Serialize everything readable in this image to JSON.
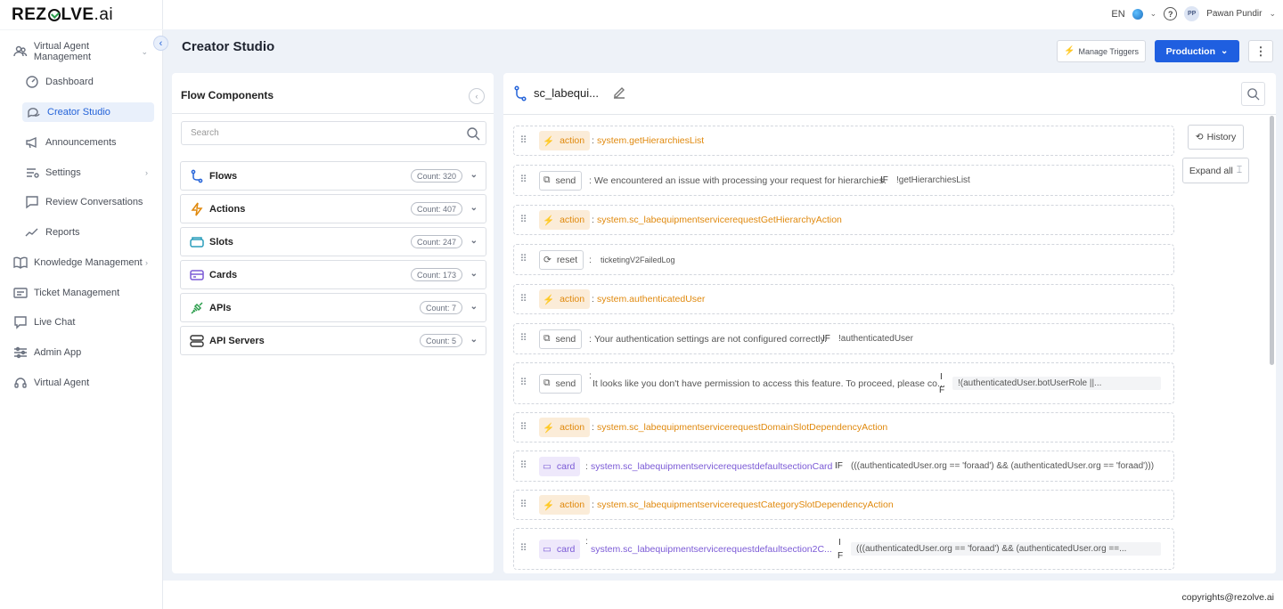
{
  "app": {
    "logo_main": "REZ",
    "logo_rest": "LVE",
    "logo_ai": ".ai",
    "page_title": "Creator Studio",
    "footer": "copyrights@rezolve.ai"
  },
  "topbar": {
    "language": "EN",
    "avatar_initials": "PP",
    "user_name": "Pawan Pundir"
  },
  "header_actions": {
    "manage_triggers": "Manage Triggers",
    "environment": "Production"
  },
  "sidebar": {
    "items": [
      {
        "label": "Virtual Agent Management",
        "icon": "users-icon"
      },
      {
        "label": "Dashboard",
        "icon": "gauge-icon"
      },
      {
        "label": "Creator Studio",
        "icon": "chat-icon"
      },
      {
        "label": "Announcements",
        "icon": "megaphone-icon"
      },
      {
        "label": "Settings",
        "icon": "settings-icon"
      },
      {
        "label": "Review Conversations",
        "icon": "message-square-icon"
      },
      {
        "label": "Reports",
        "icon": "trend-icon"
      },
      {
        "label": "Knowledge Management",
        "icon": "book-icon"
      },
      {
        "label": "Ticket Management",
        "icon": "ticket-icon"
      },
      {
        "label": "Live Chat",
        "icon": "live-chat-icon"
      },
      {
        "label": "Admin App",
        "icon": "sliders-icon"
      },
      {
        "label": "Virtual Agent",
        "icon": "headset-icon"
      }
    ]
  },
  "components": {
    "title": "Flow Components",
    "search_placeholder": "Search",
    "items": [
      {
        "label": "Flows",
        "count": "Count: 320"
      },
      {
        "label": "Actions",
        "count": "Count: 407"
      },
      {
        "label": "Slots",
        "count": "Count: 247"
      },
      {
        "label": "Cards",
        "count": "Count: 173"
      },
      {
        "label": "APIs",
        "count": "Count: 7"
      },
      {
        "label": "API Servers",
        "count": "Count: 5"
      }
    ]
  },
  "flow": {
    "name": "sc_labequi...",
    "history": "History",
    "expand_all": "Expand all",
    "colon": ":",
    "rows": [
      {
        "type": "action",
        "text": "system.getHierarchiesList"
      },
      {
        "type": "send",
        "text": "We encountered an issue with processing your request for hierarchies.",
        "kw": "IF",
        "cond": "!getHierarchiesList"
      },
      {
        "type": "action",
        "text": "system.sc_labequipmentservicerequestGetHierarchyAction"
      },
      {
        "type": "reset",
        "text": "ticketingV2FailedLog"
      },
      {
        "type": "action",
        "text": "system.authenticatedUser"
      },
      {
        "type": "send",
        "text": "Your authentication settings are not configured correctly.",
        "kw": "IF",
        "cond": "!authenticatedUser"
      },
      {
        "type": "send",
        "text": "It looks like you don't have permission to access this feature. To proceed, please co...",
        "kw1": "I",
        "kw2": "F",
        "cond": "!(authenticatedUser.botUserRole ||..."
      },
      {
        "type": "action",
        "text": "system.sc_labequipmentservicerequestDomainSlotDependencyAction"
      },
      {
        "type": "card",
        "text": "system.sc_labequipmentservicerequestdefaultsectionCard",
        "kw": "IF",
        "cond": "(((authenticatedUser.org == 'foraad') && (authenticatedUser.org == 'foraad')))"
      },
      {
        "type": "action",
        "text": "system.sc_labequipmentservicerequestCategorySlotDependencyAction"
      },
      {
        "type": "card",
        "text": "system.sc_labequipmentservicerequestdefaultsection2C...",
        "kw1": "I",
        "kw2": "F",
        "cond": "(((authenticatedUser.org == 'foraad') && (authenticatedUser.org ==..."
      }
    ]
  },
  "colors": {
    "primary": "#1f5fe0",
    "action": "#e0890d",
    "card": "#7b5ad6"
  }
}
